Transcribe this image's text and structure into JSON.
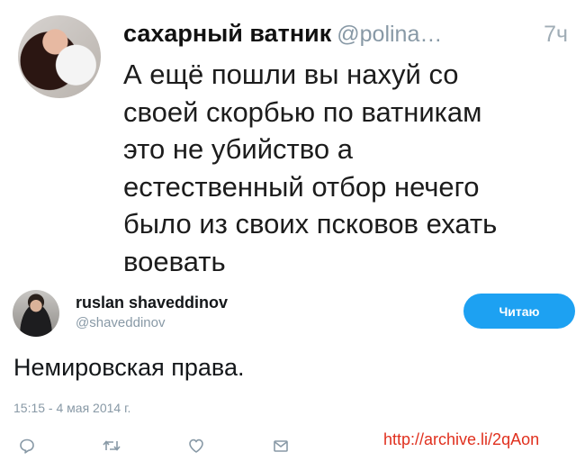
{
  "tweet1": {
    "author_name": "сахарный ватник",
    "handle": "@polina…",
    "time": "7ч",
    "text": "А ещё пошли вы нахуй со\nсвоей скорбью по ватникам\nэто не убийство а\nестественный отбор нечего\nбыло из своих псковов ехать\nвоевать"
  },
  "tweet2": {
    "author_name": "ruslan shaveddinov",
    "handle": "@shaveddinov",
    "follow_label": "Читаю",
    "text": "Немировская права.",
    "date": "15:15 - 4 мая 2014 г.",
    "actions": [
      "reply-icon",
      "retweet-icon",
      "like-icon",
      "message-icon"
    ]
  },
  "archive_link": "http://archive.li/2qAon",
  "colors": {
    "accent": "#1da1f2",
    "muted": "#8899a6",
    "link_red": "#e0301e"
  }
}
